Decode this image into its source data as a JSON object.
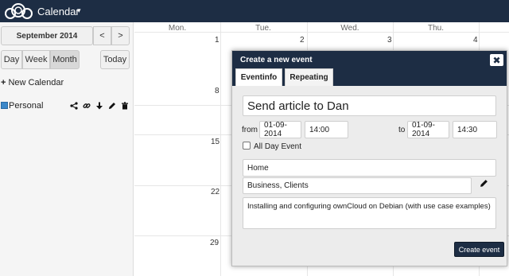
{
  "header": {
    "app_title": "Calendar",
    "caret": "▾"
  },
  "sidebar": {
    "month_label": "September 2014",
    "prev_label": "<",
    "next_label": ">",
    "views": {
      "day": "Day",
      "week": "Week",
      "month": "Month"
    },
    "today_label": "Today",
    "new_calendar_label": "New Calendar",
    "calendars": [
      {
        "name": "Personal",
        "color": "#3b87c9"
      }
    ]
  },
  "grid": {
    "weekdays": [
      "Mon.",
      "Tue.",
      "Wed.",
      "Thu."
    ],
    "dates": [
      "1",
      "2",
      "3",
      "4",
      "8",
      "15",
      "22",
      "29"
    ]
  },
  "dialog": {
    "title": "Create a new event",
    "close": "✖",
    "tabs": [
      "Eventinfo",
      "Repeating"
    ],
    "event_title": "Send article to Dan",
    "from_label": "from",
    "from_date": "01-09-2014",
    "from_time": "14:00",
    "to_label": "to",
    "to_date": "01-09-2014",
    "to_time": "14:30",
    "all_day_label": "All Day Event",
    "location": "Home",
    "categories": "Business, Clients",
    "description": "Installing and configuring ownCloud on Debian (with use case examples)",
    "create_label": "Create event"
  },
  "colors": {
    "header_bg": "#1d2d44",
    "accent": "#1d2d44"
  }
}
